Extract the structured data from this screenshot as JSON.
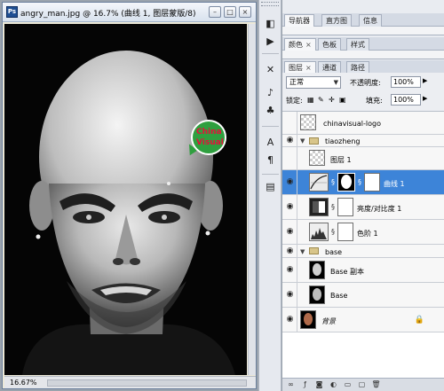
{
  "document": {
    "title": "angry_man.jpg @ 16.7% (曲线 1, 图层蒙版/8)",
    "app_icon": "Ps",
    "zoom_readout": "16.67%",
    "watermark": {
      "line1": "China",
      "line2": "Visual"
    }
  },
  "toolstrip": {
    "tools": [
      "navigator-icon",
      "histogram-icon",
      "brush-settings-icon",
      "tool-presets-icon",
      "clone-source-icon",
      "character-icon",
      "paragraph-icon",
      "layer-comps-icon"
    ]
  },
  "panels": {
    "top_tabs": [
      "导航器",
      "直方图",
      "信息"
    ],
    "mid_tabs": [
      "颜色",
      "色板",
      "样式"
    ],
    "layer_tabs": [
      "图层",
      "通道",
      "路径"
    ]
  },
  "layers_panel": {
    "blend_mode": "正常",
    "opacity_label": "不透明度:",
    "opacity_value": "100%",
    "lock_label": "锁定:",
    "fill_label": "填充:",
    "fill_value": "100%",
    "layers": [
      {
        "name": "chinavisual-logo"
      },
      {
        "name": "tiaozheng"
      },
      {
        "name": "图层 1"
      },
      {
        "name": "曲线 1"
      },
      {
        "name": "亮度/对比度 1"
      },
      {
        "name": "色阶 1"
      },
      {
        "name": "base"
      },
      {
        "name": "Base 副本"
      },
      {
        "name": "Base"
      },
      {
        "name": "背景"
      }
    ]
  },
  "colors": {
    "selection": "#3d84d8",
    "badge": "#2f9f3f",
    "badge_text": "#e5103b"
  }
}
